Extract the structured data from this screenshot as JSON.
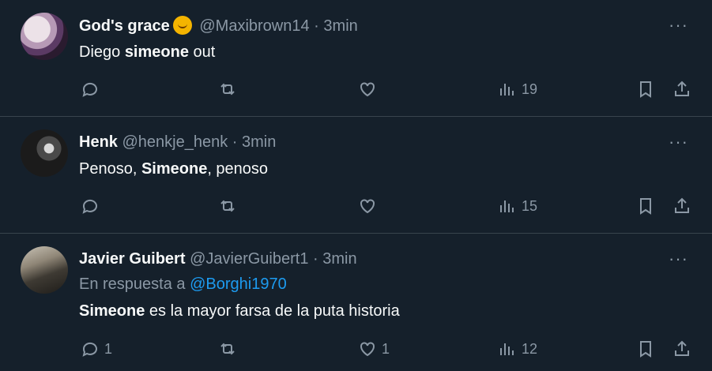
{
  "tweets": [
    {
      "name": "God's grace",
      "has_emoji": true,
      "emoji": "hugging-face-emoji",
      "handle": "@Maxibrown14",
      "sep": "·",
      "time": "3min",
      "text_before": "Diego ",
      "text_bold": "simeone",
      "text_after": " out",
      "reply_count": "",
      "like_count": "",
      "views": "19"
    },
    {
      "name": "Henk",
      "handle": "@henkje_henk",
      "sep": "·",
      "time": "3min",
      "text_before": "Penoso, ",
      "text_bold": "Simeone",
      "text_after": ", penoso",
      "reply_count": "",
      "like_count": "",
      "views": "15"
    },
    {
      "name": "Javier Guibert",
      "handle": "@JavierGuibert1",
      "sep": "·",
      "time": "3min",
      "reply_prefix": "En respuesta a",
      "reply_to": "@Borghi1970",
      "text_before": "",
      "text_bold": "Simeone",
      "text_after": " es la mayor farsa de la puta historia",
      "reply_count": "1",
      "like_count": "1",
      "views": "12"
    }
  ],
  "more_glyph": "···",
  "colors": {
    "background": "#15202b",
    "muted": "#8b98a5",
    "link": "#1d9bf0",
    "divider": "#38444d"
  }
}
